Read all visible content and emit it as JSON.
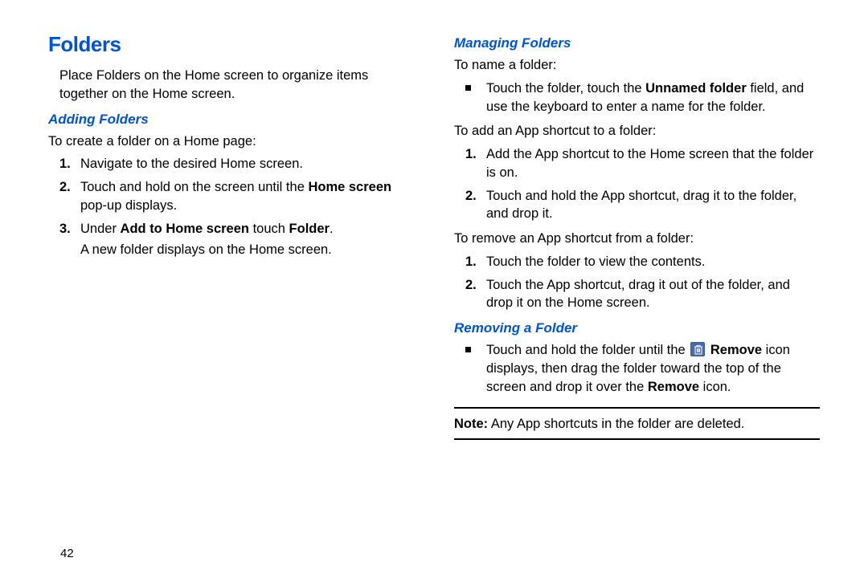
{
  "pageNumber": "42",
  "left": {
    "sectionTitle": "Folders",
    "intro": "Place Folders on the Home screen to organize items together on the Home screen.",
    "adding": {
      "title": "Adding Folders",
      "lead": "To create a folder on a Home page:",
      "steps": {
        "s1": {
          "num": "1.",
          "text": "Navigate to the desired Home screen."
        },
        "s2": {
          "num": "2.",
          "pre": "Touch and hold on the screen until the ",
          "bold1": "Home screen",
          "post": " pop-up displays."
        },
        "s3": {
          "num": "3.",
          "pre": "Under ",
          "bold1": "Add to Home screen",
          "mid": " touch ",
          "bold2": "Folder",
          "post": "."
        }
      },
      "after": "A new folder displays on the Home screen."
    }
  },
  "right": {
    "managing": {
      "title": "Managing Folders",
      "nameLead": "To name a folder:",
      "nameBullet": {
        "pre": "Touch the folder, touch the ",
        "bold1": "Unnamed folder",
        "post": " field, and use the keyboard to enter a name for the folder."
      },
      "addLead": "To add an App shortcut to a folder:",
      "addSteps": {
        "s1": {
          "num": "1.",
          "text": "Add the App shortcut to the Home screen that the folder is on."
        },
        "s2": {
          "num": "2.",
          "text": "Touch and hold the App shortcut, drag it to the folder, and drop it."
        }
      },
      "removeLead": "To remove an App shortcut from a folder:",
      "removeSteps": {
        "s1": {
          "num": "1.",
          "text": "Touch the folder to view the contents."
        },
        "s2": {
          "num": "2.",
          "text": "Touch the App shortcut, drag it out of the folder, and drop it on the Home screen."
        }
      }
    },
    "removing": {
      "title": "Removing a Folder",
      "bullet": {
        "pre": "Touch and hold the folder until the ",
        "iconLabel": "Remove",
        "mid": " icon displays, then drag the folder toward the top of the screen and drop it over the ",
        "bold2": "Remove",
        "post": " icon."
      }
    },
    "note": {
      "label": "Note:",
      "text": " Any App shortcuts in the folder are deleted."
    }
  }
}
